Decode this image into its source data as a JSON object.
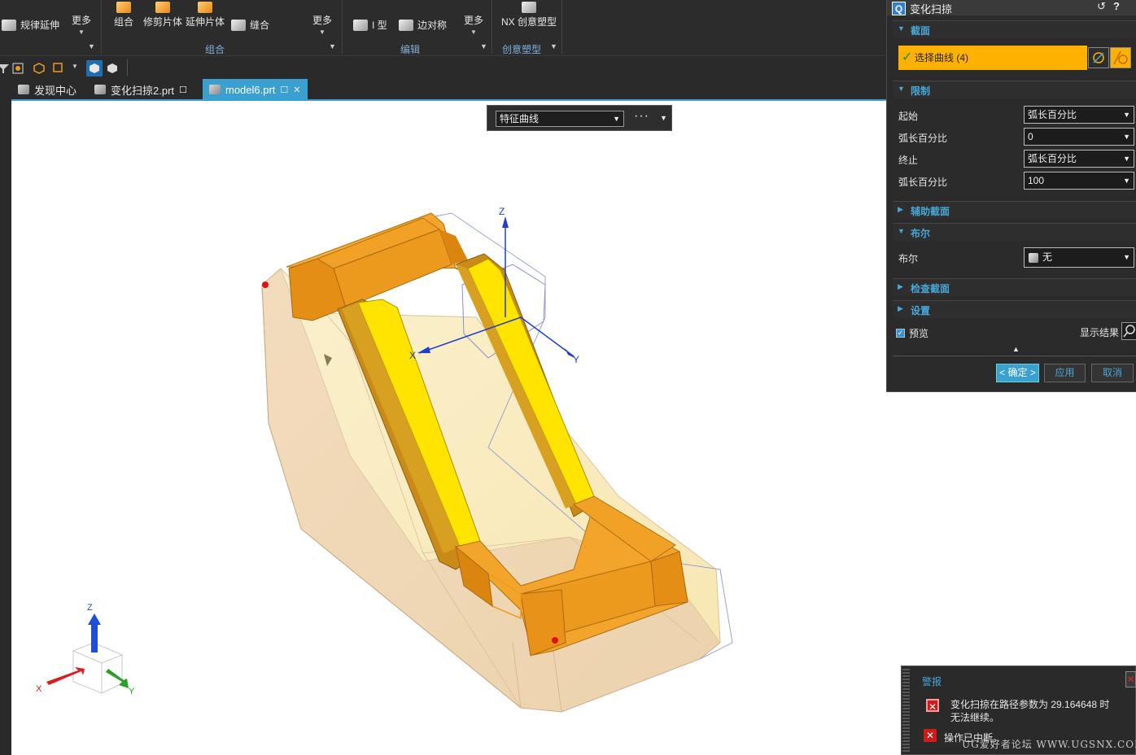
{
  "ribbon": {
    "left_group": {
      "law_extend": "规律延伸",
      "more": "更多"
    },
    "combine_group": {
      "combine": "组合",
      "trim_sheet": "修剪片体",
      "extend_sheet": "延伸片体",
      "sew": "缝合",
      "more": "更多",
      "group_label": "组合"
    },
    "edit_group": {
      "i_type": "I 型",
      "edge_symmetric": "边对称",
      "more": "更多",
      "group_label": "编辑"
    },
    "creative_group": {
      "nx_creative": "NX 创意塑型",
      "group_label": "创意塑型"
    }
  },
  "tabs": [
    {
      "label": "发现中心"
    },
    {
      "label": "变化扫掠2.prt"
    },
    {
      "label": "model6.prt"
    }
  ],
  "selection_bar": {
    "filter_value": "特征曲线",
    "more": "···"
  },
  "viewport": {
    "triad_z": "Z",
    "triad_x": "X",
    "triad_y": "Y",
    "wcs_z": "Z",
    "wcs_x": "X",
    "wcs_y": "Y"
  },
  "dialog": {
    "title": "变化扫掠",
    "section_label": "截面",
    "select_curve": "选择曲线 (4)",
    "limits_label": "限制",
    "start_label": "起始",
    "start_value": "弧长百分比",
    "arc_pct_label_1": "弧长百分比",
    "arc_pct_value_1": "0",
    "end_label": "终止",
    "end_value": "弧长百分比",
    "arc_pct_label_2": "弧长百分比",
    "arc_pct_value_2": "100",
    "aux_section": "辅助截面",
    "boolean_section": "布尔",
    "boolean_label": "布尔",
    "boolean_value": "无",
    "check_section": "检查截面",
    "settings_section": "设置",
    "preview": "预览",
    "show_result": "显示结果",
    "ok": "< 确定 >",
    "apply": "应用",
    "cancel": "取消"
  },
  "alert": {
    "title": "警报",
    "message": "变化扫掠在路径参数为 29.164648 时无法继续。",
    "status": "操作已中断。",
    "watermark": "UG爱好者论坛 WWW.UGSNX.COM"
  },
  "colors": {
    "accent_blue": "#3aa0d0",
    "select_highlight": "#ffb100",
    "error_red": "#d21a1a",
    "sweep_orange": "#f0a020",
    "sweep_yellow": "#ffe400",
    "base_beige": "#f2dcc0"
  }
}
